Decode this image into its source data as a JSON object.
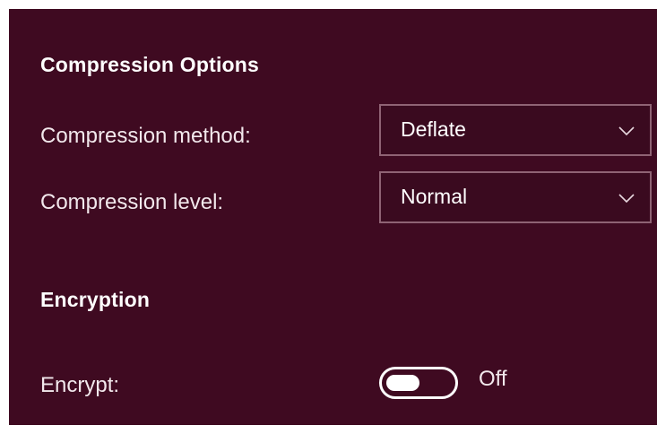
{
  "compression": {
    "title": "Compression Options",
    "method": {
      "label": "Compression method:",
      "value": "Deflate"
    },
    "level": {
      "label": "Compression level:",
      "value": "Normal"
    }
  },
  "encryption": {
    "title": "Encryption",
    "encrypt": {
      "label": "Encrypt:",
      "state_text": "Off",
      "on": false
    }
  },
  "colors": {
    "panel_background": "#3f0a21",
    "dropdown_border": "#8f6374",
    "text": "#ffffff"
  },
  "icons": {
    "dropdown": "chevron-down-icon"
  }
}
